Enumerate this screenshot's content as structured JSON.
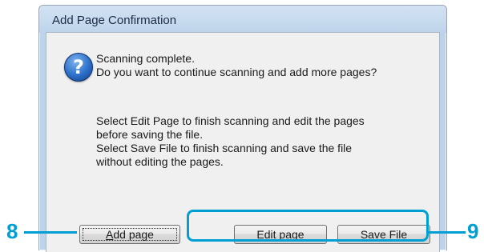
{
  "dialog": {
    "title": "Add Page Confirmation",
    "icon": "question-icon",
    "icon_glyph": "?",
    "message_line1": "Scanning complete.",
    "message_line2": "Do you want to continue scanning and add more pages?",
    "info_lines": [
      "Select Edit Page to finish scanning and edit the pages",
      "before saving the file.",
      "Select Save File to finish scanning and save the file",
      "without editing the pages."
    ]
  },
  "buttons": {
    "add_page": {
      "mnemonic": "A",
      "rest": "dd page"
    },
    "edit_page": {
      "label": "Edit page"
    },
    "save_file": {
      "mnemonic": "S",
      "rest": "ave File"
    }
  },
  "callouts": {
    "left_number": "8",
    "right_number": "9",
    "color": "#009fd3"
  }
}
